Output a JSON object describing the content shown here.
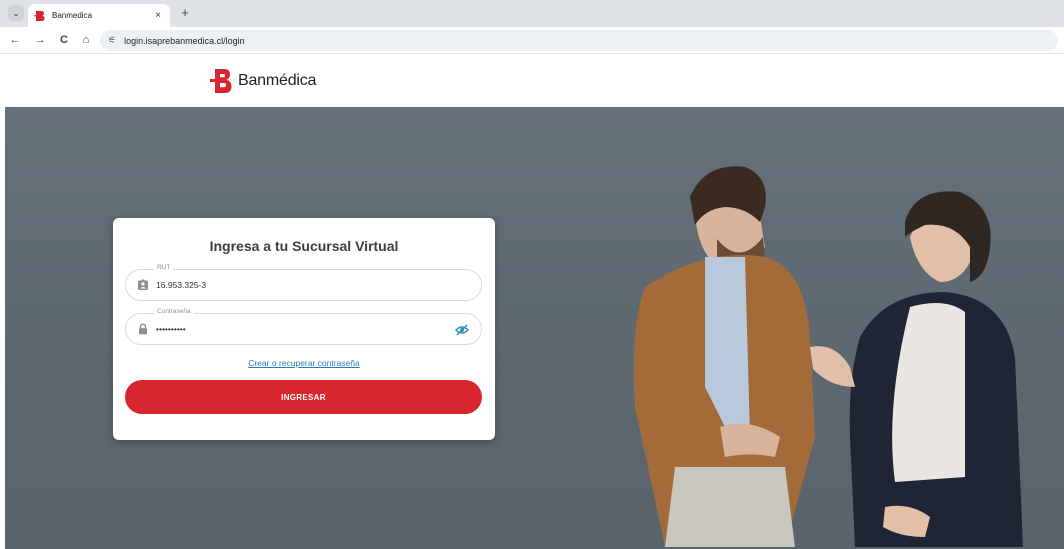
{
  "browser": {
    "tab_title": "Banmedica",
    "tab_close": "×",
    "new_tab": "+",
    "url": "login.isaprebanmedica.cl/login",
    "back": "←",
    "forward": "→",
    "reload": "C",
    "home": "⌂",
    "site_info": "⚟"
  },
  "header": {
    "brand": "Banmédica",
    "brand_color": "#d8262e"
  },
  "login": {
    "title": "Ingresa a tu Sucursal Virtual",
    "rut_label": "RUT",
    "rut_value": "16.953.325-3",
    "password_label": "Contraseña",
    "password_value": "••••••••••",
    "recover_link": "Crear o recuperar contraseña",
    "submit_label": "INGRESAR",
    "accent_color": "#d8262e",
    "link_color": "#2a7abf"
  }
}
